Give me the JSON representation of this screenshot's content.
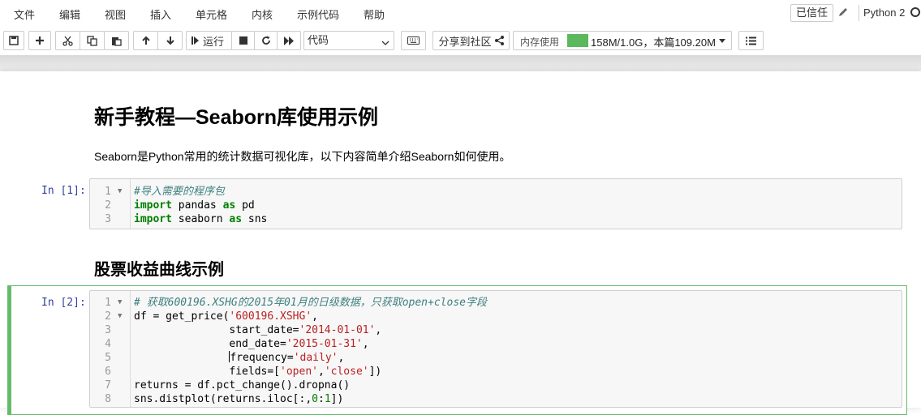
{
  "menubar": {
    "items": [
      "文件",
      "编辑",
      "视图",
      "插入",
      "单元格",
      "内核",
      "示例代码",
      "帮助"
    ],
    "trusted_label": "已信任",
    "kernel_name": "Python 2"
  },
  "toolbar": {
    "run_label": "运行",
    "cell_type_value": "代码",
    "share_label": "分享到社区",
    "memory_label": "内存使用",
    "memory_text": "158M/1.0G，本篇109.20M",
    "memory_bar_color": "#5cb85c",
    "icons": [
      "save-icon",
      "plus-icon",
      "cut-icon",
      "copy-icon",
      "paste-icon",
      "arrow-up-icon",
      "arrow-down-icon",
      "step-forward-icon",
      "stop-icon",
      "restart-icon",
      "fast-forward-icon",
      "keyboard-icon",
      "share-icon",
      "list-icon"
    ]
  },
  "notebook": {
    "title": "新手教程—Seaborn库使用示例",
    "intro": "Seaborn是Python常用的统计数据可视化库，以下内容简单介绍Seaborn如何使用。",
    "cell1": {
      "prompt": "In [1]:",
      "lines": [
        {
          "n": "1",
          "fold": "▼",
          "parts": [
            {
              "t": "#导入需要的程序包",
              "c": "cm"
            }
          ]
        },
        {
          "n": "2",
          "fold": "",
          "parts": [
            {
              "t": "import",
              "c": "kw"
            },
            {
              "t": " pandas ",
              "c": ""
            },
            {
              "t": "as",
              "c": "kw"
            },
            {
              "t": " pd",
              "c": ""
            }
          ]
        },
        {
          "n": "3",
          "fold": "",
          "parts": [
            {
              "t": "import",
              "c": "kw"
            },
            {
              "t": " seaborn ",
              "c": ""
            },
            {
              "t": "as",
              "c": "kw"
            },
            {
              "t": " sns",
              "c": ""
            }
          ]
        }
      ]
    },
    "section_heading": "股票收益曲线示例",
    "cell2": {
      "prompt": "In [2]:",
      "lines": [
        {
          "n": "1",
          "fold": "▼",
          "parts": [
            {
              "t": "# 获取600196.XSHG的2015年01月的日级数据，只获取open+close字段",
              "c": "cm"
            }
          ]
        },
        {
          "n": "2",
          "fold": "▼",
          "parts": [
            {
              "t": "df = get_price(",
              "c": ""
            },
            {
              "t": "'600196.XSHG'",
              "c": "st"
            },
            {
              "t": ",",
              "c": ""
            }
          ]
        },
        {
          "n": "3",
          "fold": "",
          "parts": [
            {
              "t": "               start_date=",
              "c": ""
            },
            {
              "t": "'2014-01-01'",
              "c": "st"
            },
            {
              "t": ",",
              "c": ""
            }
          ]
        },
        {
          "n": "4",
          "fold": "",
          "parts": [
            {
              "t": "               end_date=",
              "c": ""
            },
            {
              "t": "'2015-01-31'",
              "c": "st"
            },
            {
              "t": ",",
              "c": ""
            }
          ]
        },
        {
          "n": "5",
          "fold": "",
          "parts": [
            {
              "t": "               ",
              "c": ""
            },
            {
              "t": "|",
              "c": "cursor"
            },
            {
              "t": "frequency=",
              "c": ""
            },
            {
              "t": "'daily'",
              "c": "st"
            },
            {
              "t": ",",
              "c": ""
            }
          ]
        },
        {
          "n": "6",
          "fold": "",
          "parts": [
            {
              "t": "               fields=[",
              "c": ""
            },
            {
              "t": "'open'",
              "c": "st"
            },
            {
              "t": ",",
              "c": ""
            },
            {
              "t": "'close'",
              "c": "st"
            },
            {
              "t": "])",
              "c": ""
            }
          ]
        },
        {
          "n": "7",
          "fold": "",
          "parts": [
            {
              "t": "returns = df.pct_change().dropna()",
              "c": ""
            }
          ]
        },
        {
          "n": "8",
          "fold": "",
          "parts": [
            {
              "t": "sns.distplot(returns.iloc[:,",
              "c": ""
            },
            {
              "t": "0",
              "c": "nm"
            },
            {
              "t": ":",
              "c": ""
            },
            {
              "t": "1",
              "c": "nm"
            },
            {
              "t": "])",
              "c": ""
            }
          ]
        }
      ]
    }
  }
}
